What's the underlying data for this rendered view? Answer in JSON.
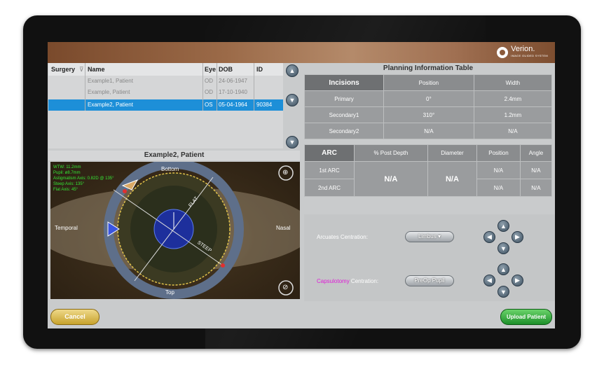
{
  "brand": {
    "name": "Verion.",
    "subtitle": "IMAGE GUIDED SYSTEM"
  },
  "patient_table": {
    "columns": [
      "Surgery",
      "Name",
      "Eye",
      "DOB",
      "ID"
    ],
    "rows": [
      {
        "name": "Example1, Patient",
        "eye": "OD",
        "dob": "24-06-1947",
        "id": ""
      },
      {
        "name": "Example, Patient",
        "eye": "OD",
        "dob": "17-10-1940",
        "id": ""
      },
      {
        "name": "Example2, Patient",
        "eye": "OS",
        "dob": "05-04-1964",
        "id": "90384",
        "selected": true
      }
    ]
  },
  "planning": {
    "title": "Planning Information Table",
    "incisions_header": [
      "Incisions",
      "Position",
      "Width"
    ],
    "incisions": [
      {
        "label": "Primary",
        "position": "0°",
        "width": "2.4mm"
      },
      {
        "label": "Secondary1",
        "position": "310°",
        "width": "1.2mm"
      },
      {
        "label": "Secondary2",
        "position": "N/A",
        "width": "N/A"
      }
    ],
    "arc_header": [
      "ARC",
      "% Post Depth",
      "Diameter",
      "Position",
      "Angle"
    ],
    "arcs": [
      {
        "label": "1st ARC",
        "position": "N/A",
        "angle": "N/A"
      },
      {
        "label": "2nd ARC",
        "position": "N/A",
        "angle": "N/A"
      }
    ],
    "post_depth": "N/A",
    "diameter": "N/A"
  },
  "eye_view": {
    "title": "Example2, Patient",
    "overlay": [
      "WTW: 11.2mm",
      "Pupil: ø8.7mm",
      "Astigmatism Axis: 0.82D @ 135°",
      "Steep Axis: 135°",
      "Flat Axis: 45°"
    ],
    "labels": {
      "top": "Bottom",
      "bottom": "Top",
      "left": "Temporal",
      "right": "Nasal",
      "flat": "FLAT",
      "steep": "STEEP"
    }
  },
  "controls": {
    "arcuates_word": "Arcuates",
    "arcuates_label": "Centration:",
    "arcuates_value": "Limbus",
    "capsulotomy_word": "Capsulotomy",
    "capsulotomy_label": "Centration:",
    "capsulotomy_value": "PreOp Pupil"
  },
  "buttons": {
    "cancel": "Cancel",
    "upload": "Upload Patient"
  },
  "colors": {
    "selected_row": "#1d8fd8",
    "capsulotomy": "#e01bd8",
    "cancel": "#c7a22c",
    "upload": "#1d8f2a"
  }
}
